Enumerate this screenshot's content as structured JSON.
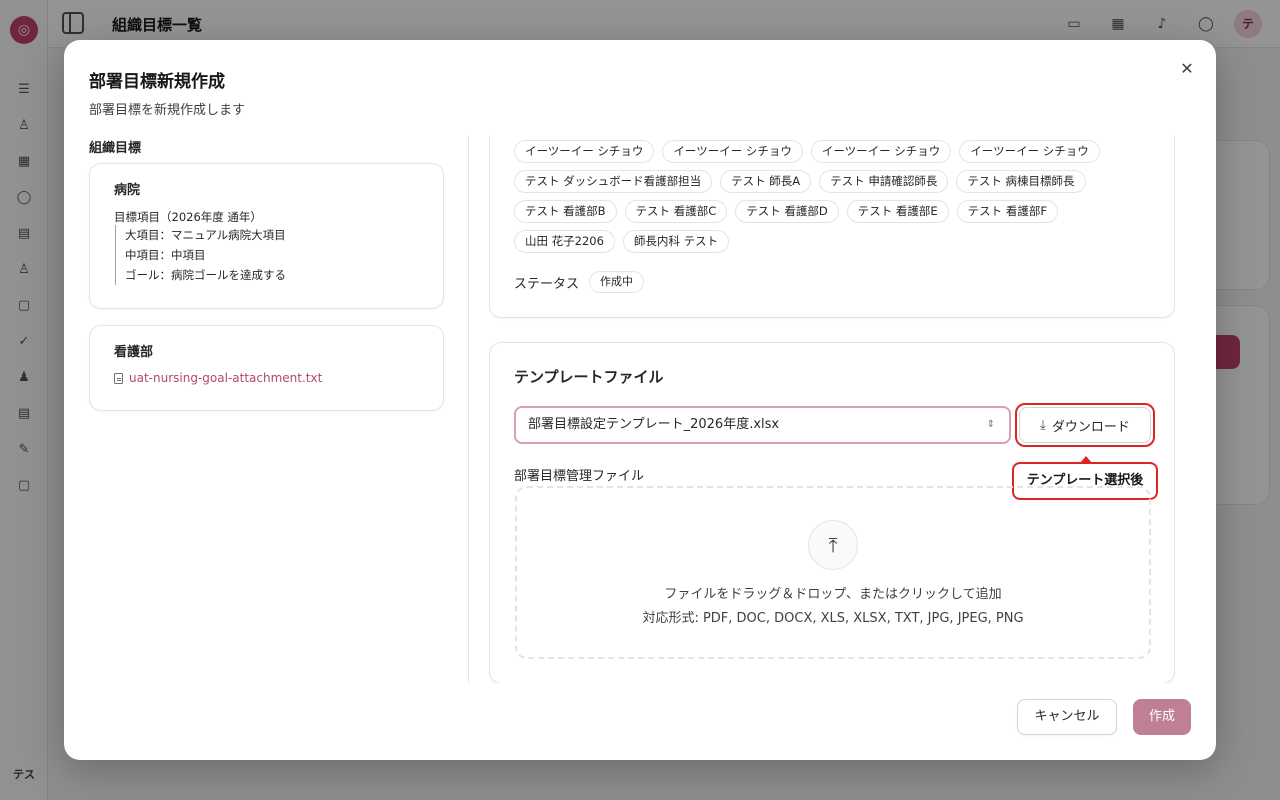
{
  "app": {
    "header_title": "組織目標一覧",
    "logo_glyph": "◎",
    "user_initials": "テス",
    "avatar_initial": "テ",
    "sidebar_icons": [
      "list-icon",
      "user-icon",
      "calendar-icon",
      "chat-icon",
      "document-icon",
      "person-icon",
      "file-icon",
      "check-icon",
      "users-icon",
      "report-icon",
      "edit-icon",
      "clipboard-icon"
    ],
    "header_icons": [
      "message-icon",
      "calendar-icon",
      "bell-icon",
      "chat-icon"
    ]
  },
  "modal": {
    "title": "部署目標新規作成",
    "description": "部署目標を新規作成します",
    "close_glyph": "✕"
  },
  "org_goals": {
    "label": "組織目標",
    "hospital": {
      "title": "病院",
      "goal_heading": "目標項目（2026年度 通年）",
      "items": [
        "大項目：マニュアル病院大項目",
        "中項目：中項目",
        "ゴール：病院ゴールを達成する"
      ]
    },
    "nursing": {
      "title": "看護部",
      "attachment": "uat-nursing-goal-attachment.txt"
    }
  },
  "members": {
    "tags": [
      "イーツーイー シチョウ",
      "イーツーイー シチョウ",
      "イーツーイー シチョウ",
      "イーツーイー シチョウ",
      "テスト ダッシュボード看護部担当",
      "テスト 師長A",
      "テスト 申請確認師長",
      "テスト 病棟目標師長",
      "テスト 看護部B",
      "テスト 看護部C",
      "テスト 看護部D",
      "テスト 看護部E",
      "テスト 看護部F",
      "山田 花子2206",
      "師長内科 テスト"
    ],
    "status_label": "ステータス",
    "status_value": "作成中"
  },
  "template": {
    "title": "テンプレートファイル",
    "selected": "部署目標設定テンプレート_2026年度.xlsx",
    "download_label": "ダウンロード",
    "tooltip": "テンプレート選択後",
    "management_label": "部署目標管理ファイル",
    "drop_text": "ファイルをドラッグ＆ドロップ、またはクリックして追加",
    "formats": "対応形式: PDF, DOC, DOCX, XLS, XLSX, TXT, JPG, JPEG, PNG"
  },
  "footer": {
    "cancel_label": "キャンセル",
    "create_label": "作成"
  },
  "colors": {
    "accent": "#c2416b",
    "create_button": "#c08094",
    "highlight": "#dc2626"
  }
}
